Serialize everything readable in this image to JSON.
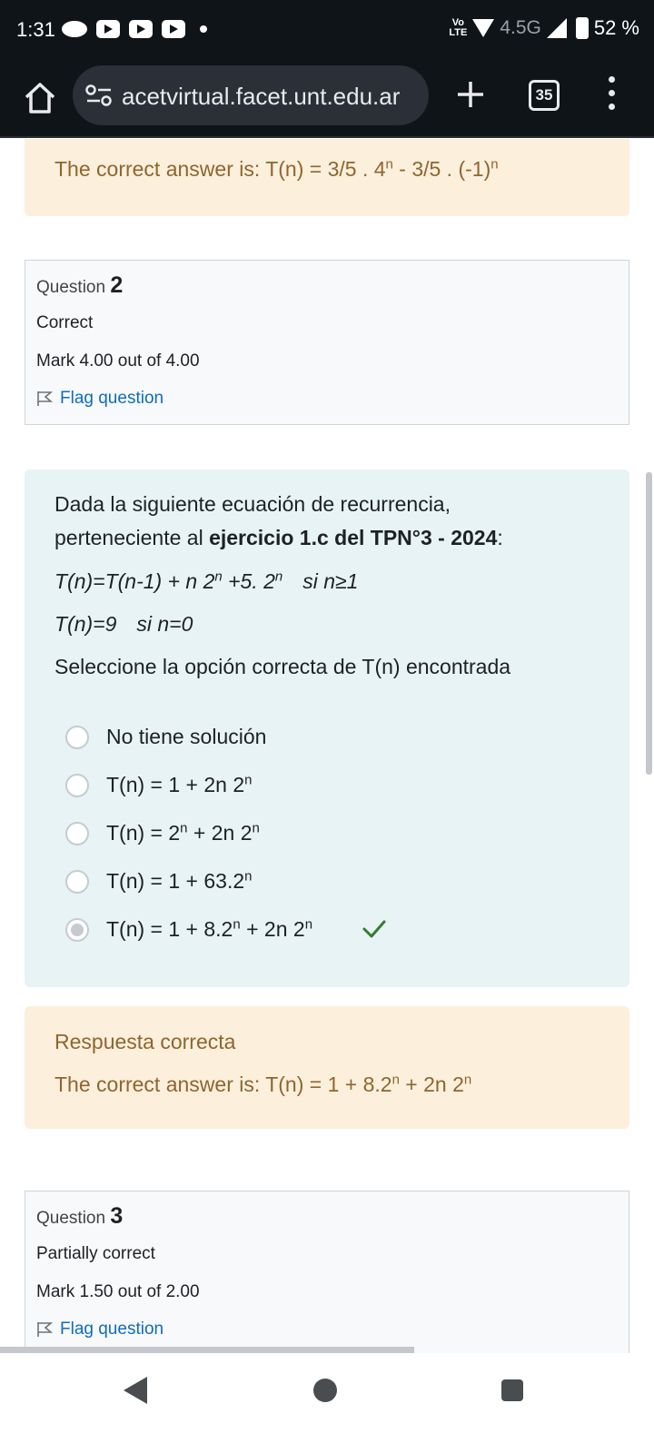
{
  "status_bar": {
    "time": "1:31",
    "volte_top": "Vo",
    "volte_bottom": "LTE",
    "network": "4.5G",
    "battery": "52 %"
  },
  "browser": {
    "url": "acetvirtual.facet.unt.edu.ar",
    "tab_count": "35"
  },
  "previous_feedback": {
    "answer_prefix": "The correct answer is: T(n) = 3/5 . 4",
    "answer_mid": " - 3/5 . (-1)",
    "sup": "n"
  },
  "question2_info": {
    "label": "Question ",
    "number": "2",
    "state": "Correct",
    "mark": "Mark 4.00 out of 4.00",
    "flag": "Flag question"
  },
  "question2": {
    "intro_line1": "Dada la siguiente ecuación de recurrencia,",
    "intro_line2_prefix": "perteneciente al ",
    "intro_line2_bold": "ejercicio 1.c del TPN°3 - 2024",
    "intro_line2_suffix": ":",
    "eq1_a": "T(n)=T(n-1) + n 2",
    "eq1_b": " +5. 2",
    "eq1_cond": "si n≥1",
    "eq2": "T(n)=9",
    "eq2_cond": "si n=0",
    "prompt": "Seleccione la opción correcta de T(n) encontrada",
    "sup": "n",
    "options": [
      {
        "a": "No tiene solución",
        "b": "",
        "c": "",
        "checked": false
      },
      {
        "a": "T(n) = 1  +  2n 2",
        "b": "",
        "c": "",
        "checked": false
      },
      {
        "a": "T(n) =  2",
        "b": " + 2n 2",
        "c": "",
        "checked": false
      },
      {
        "a": "T(n) = 1  + 63.2",
        "b": "",
        "c": "",
        "checked": false
      },
      {
        "a": "T(n) = 1  + 8.2",
        "b": " + 2n 2",
        "c": "",
        "checked": true
      }
    ]
  },
  "question2_feedback": {
    "result": "Respuesta correcta",
    "answer_a": "The correct answer is: T(n) = 1  + 8.2",
    "answer_b": " + 2n 2",
    "sup": "n"
  },
  "question3_info": {
    "label": "Question ",
    "number": "3",
    "state": "Partially correct",
    "mark": "Mark 1.50 out of 2.00",
    "flag": "Flag question"
  },
  "colors": {
    "feedback_bg": "#fcefdc",
    "feedback_text": "#8e662e",
    "question_bg": "#e7f3f5",
    "link": "#0f6cbf",
    "check": "#357a32"
  }
}
